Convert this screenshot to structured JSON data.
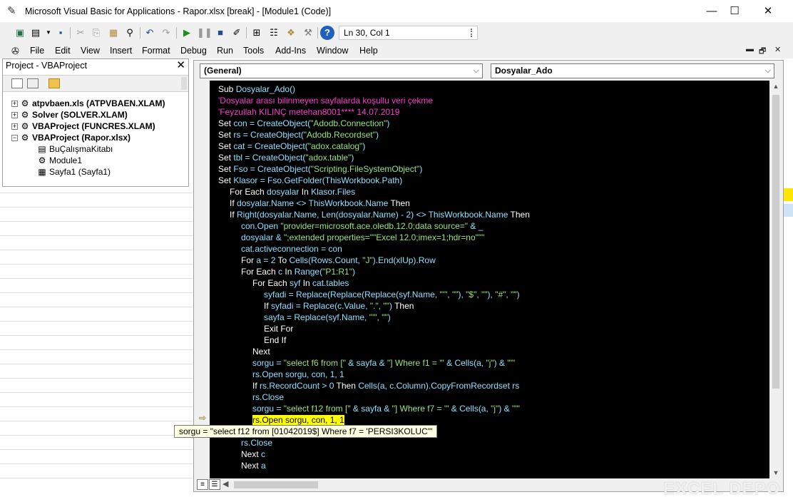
{
  "window": {
    "title": "Microsoft Visual Basic for Applications - Rapor.xlsx [break] - [Module1 (Code)]",
    "minimize": "—",
    "maximize": "☐",
    "close": "✕"
  },
  "toolbar": {
    "position": "Ln 30, Col 1",
    "icons": [
      "excel-view",
      "insert-userform",
      "save",
      "cut",
      "copy",
      "paste",
      "find",
      "undo",
      "redo",
      "run",
      "break",
      "reset",
      "design-mode",
      "project-explorer",
      "properties",
      "object-browser",
      "toolbox",
      "help"
    ]
  },
  "menu": {
    "items": [
      "File",
      "Edit",
      "View",
      "Insert",
      "Format",
      "Debug",
      "Run",
      "Tools",
      "Add-Ins",
      "Window",
      "Help"
    ],
    "accelerators": [
      "F",
      "E",
      "V",
      "I",
      "o",
      "D",
      "R",
      "T",
      "A",
      "W",
      "H"
    ],
    "mdi_minimize": "▬",
    "mdi_restore": "🗗",
    "mdi_close": "✕"
  },
  "project": {
    "title": "Project - VBAProject",
    "close": "✕",
    "tree": [
      {
        "label": "atpvbaen.xls (ATPVBAEN.XLAM)",
        "expander": "+",
        "bold": true
      },
      {
        "label": "Solver (SOLVER.XLAM)",
        "expander": "+",
        "bold": true
      },
      {
        "label": "VBAProject (FUNCRES.XLAM)",
        "expander": "+",
        "bold": true
      },
      {
        "label": "VBAProject (Rapor.xlsx)",
        "expander": "−",
        "bold": true
      },
      {
        "label": "BuÇalışmaKitabı",
        "expander": "",
        "bold": false
      },
      {
        "label": "Module1",
        "expander": "",
        "bold": false
      },
      {
        "label": "Sayfa1 (Sayfa1)",
        "expander": "",
        "bold": false
      }
    ]
  },
  "code_window": {
    "object_dropdown": "(General)",
    "procedure_dropdown": "Dosyalar_Ado",
    "tooltip": "sorgu = \"select f12 from [01042019$] Where f7 = 'PERSI3KOLUC'\"",
    "lines": [
      {
        "indent": 0,
        "parts": [
          [
            "kw",
            "Sub "
          ],
          [
            "id",
            "Dosyalar_Ado()"
          ]
        ]
      },
      {
        "indent": 0,
        "parts": [
          [
            "cmt",
            "'Dosyalar arası bilinmeyen sayfalarda koşullu veri çekme"
          ]
        ]
      },
      {
        "indent": 0,
        "parts": [
          [
            "cmt",
            "'Feyzullah KILINÇ metehan8001**** 14.07.2019"
          ]
        ]
      },
      {
        "indent": 0,
        "parts": [
          [
            "kw",
            "Set "
          ],
          [
            "id",
            "con = CreateObject("
          ],
          [
            "str",
            "\"Adodb.Connection\""
          ],
          [
            "id",
            ")"
          ]
        ]
      },
      {
        "indent": 0,
        "parts": [
          [
            "kw",
            "Set "
          ],
          [
            "id",
            "rs = CreateObject("
          ],
          [
            "str",
            "\"Adodb.Recordset\""
          ],
          [
            "id",
            ")"
          ]
        ]
      },
      {
        "indent": 0,
        "parts": [
          [
            "kw",
            "Set "
          ],
          [
            "id",
            "cat = CreateObject("
          ],
          [
            "str",
            "\"adox.catalog\""
          ],
          [
            "id",
            ")"
          ]
        ]
      },
      {
        "indent": 0,
        "parts": [
          [
            "kw",
            "Set "
          ],
          [
            "id",
            "tbl = CreateObject("
          ],
          [
            "str",
            "\"adox.table\""
          ],
          [
            "id",
            ")"
          ]
        ]
      },
      {
        "indent": 0,
        "parts": [
          [
            "kw",
            "Set "
          ],
          [
            "id",
            "Fso = CreateObject("
          ],
          [
            "str",
            "\"Scripting.FileSystemObject\""
          ],
          [
            "id",
            ")"
          ]
        ]
      },
      {
        "indent": 0,
        "parts": [
          [
            "kw",
            "Set "
          ],
          [
            "id",
            "Klasor = Fso.GetFolder(ThisWorkbook.Path)"
          ]
        ]
      },
      {
        "indent": 1,
        "parts": [
          [
            "kw",
            "For Each "
          ],
          [
            "id",
            "dosyalar "
          ],
          [
            "kw",
            "In "
          ],
          [
            "id",
            "Klasor.Files"
          ]
        ]
      },
      {
        "indent": 1,
        "parts": [
          [
            "kw",
            "If "
          ],
          [
            "id",
            "dosyalar.Name <> ThisWorkbook.Name "
          ],
          [
            "kw",
            "Then"
          ]
        ]
      },
      {
        "indent": 1,
        "parts": [
          [
            "kw",
            "If "
          ],
          [
            "id",
            "Right(dosyalar.Name, Len(dosyalar.Name) - 2) <> ThisWorkbook.Name "
          ],
          [
            "kw",
            "Then"
          ]
        ]
      },
      {
        "indent": 2,
        "parts": [
          [
            "id",
            "con.Open "
          ],
          [
            "str",
            "\"provider=microsoft.ace.oledb.12.0;data source=\""
          ],
          [
            "id",
            " & _"
          ]
        ]
      },
      {
        "indent": 2,
        "parts": [
          [
            "id",
            "dosyalar & "
          ],
          [
            "str",
            "\";extended properties=\"\"Excel 12.0;imex=1;hdr=no\"\"\""
          ]
        ]
      },
      {
        "indent": 2,
        "parts": [
          [
            "id",
            "cat.activeconnection = con"
          ]
        ]
      },
      {
        "indent": 2,
        "parts": [
          [
            "kw",
            "For "
          ],
          [
            "id",
            "a = 2 "
          ],
          [
            "kw",
            "To "
          ],
          [
            "id",
            "Cells(Rows.Count, "
          ],
          [
            "str",
            "\"J\""
          ],
          [
            "id",
            ").End(xlUp).Row"
          ]
        ]
      },
      {
        "indent": 2,
        "parts": [
          [
            "kw",
            "For Each "
          ],
          [
            "id",
            "c "
          ],
          [
            "kw",
            "In "
          ],
          [
            "id",
            "Range("
          ],
          [
            "str",
            "\"P1:R1\""
          ],
          [
            "id",
            ")"
          ]
        ]
      },
      {
        "indent": 3,
        "parts": [
          [
            "kw",
            "For Each "
          ],
          [
            "id",
            "syf "
          ],
          [
            "kw",
            "In "
          ],
          [
            "id",
            "cat.tables"
          ]
        ]
      },
      {
        "indent": 4,
        "parts": [
          [
            "id",
            "syfadi = Replace(Replace(Replace(syf.Name, "
          ],
          [
            "str",
            "\"'\""
          ],
          [
            "id",
            ", "
          ],
          [
            "str",
            "\"\""
          ],
          [
            "id",
            "), "
          ],
          [
            "str",
            "\"$\""
          ],
          [
            "id",
            ", "
          ],
          [
            "str",
            "\"\""
          ],
          [
            "id",
            "), "
          ],
          [
            "str",
            "\"#\""
          ],
          [
            "id",
            ", "
          ],
          [
            "str",
            "\"\""
          ],
          [
            "id",
            ")"
          ]
        ]
      },
      {
        "indent": 4,
        "parts": [
          [
            "kw",
            "If "
          ],
          [
            "id",
            "syfadi = Replace(c.Value, "
          ],
          [
            "str",
            "\".\""
          ],
          [
            "id",
            ", "
          ],
          [
            "str",
            "\"\""
          ],
          [
            "id",
            ") "
          ],
          [
            "kw",
            "Then"
          ]
        ]
      },
      {
        "indent": 4,
        "parts": [
          [
            "id",
            "sayfa = Replace(syf.Name, "
          ],
          [
            "str",
            "\"'\""
          ],
          [
            "id",
            ", "
          ],
          [
            "str",
            "\"\""
          ],
          [
            "id",
            ")"
          ]
        ]
      },
      {
        "indent": 4,
        "parts": [
          [
            "kw",
            "Exit For"
          ]
        ]
      },
      {
        "indent": 4,
        "parts": [
          [
            "kw",
            "End If"
          ]
        ]
      },
      {
        "indent": 3,
        "parts": [
          [
            "kw",
            "Next"
          ]
        ]
      },
      {
        "indent": 3,
        "parts": [
          [
            "id",
            "sorgu = "
          ],
          [
            "str",
            "\"select f6 from [\""
          ],
          [
            "id",
            " & sayfa & "
          ],
          [
            "str",
            "\"] Where f1 = '\""
          ],
          [
            "id",
            " & Cells(a, "
          ],
          [
            "str",
            "\"j\""
          ],
          [
            "id",
            ") & "
          ],
          [
            "str",
            "\"'\""
          ]
        ]
      },
      {
        "indent": 3,
        "parts": [
          [
            "id",
            "rs.Open sorgu, con, 1, 1"
          ]
        ]
      },
      {
        "indent": 3,
        "parts": [
          [
            "kw",
            "If "
          ],
          [
            "id",
            "rs.RecordCount > 0 "
          ],
          [
            "kw",
            "Then "
          ],
          [
            "id",
            "Cells(a, c.Column).CopyFromRecordset rs"
          ]
        ]
      },
      {
        "indent": 3,
        "parts": [
          [
            "id",
            "rs.Close"
          ]
        ]
      },
      {
        "indent": 3,
        "parts": [
          [
            "id",
            "sorgu = "
          ],
          [
            "str",
            "\"select f12 from [\""
          ],
          [
            "id",
            " & sayfa & "
          ],
          [
            "str",
            "\"] Where f7 = '\""
          ],
          [
            "id",
            " & Cells(a, "
          ],
          [
            "str",
            "\"j\""
          ],
          [
            "id",
            ") & "
          ],
          [
            "str",
            "\"'\""
          ]
        ]
      },
      {
        "indent": 3,
        "parts": [
          [
            "hl",
            "rs.Open sorgu, con, 1, 1"
          ]
        ]
      },
      {
        "indent": 3,
        "parts": [
          [
            "id",
            "Cells(a, c.Column + 1).Value = "
          ],
          [
            "id",
            "rs(0)"
          ]
        ]
      },
      {
        "indent": 2,
        "parts": [
          [
            "id",
            "rs.Close"
          ]
        ]
      },
      {
        "indent": 2,
        "parts": [
          [
            "kw",
            "Next "
          ],
          [
            "id",
            "c"
          ]
        ]
      },
      {
        "indent": 2,
        "parts": [
          [
            "kw",
            "Next "
          ],
          [
            "id",
            "a"
          ]
        ]
      }
    ],
    "line30_tail": "umn).CopyFromRecordset rs"
  },
  "watermark": "EXCEL DEPO",
  "colors": {
    "code_bg": "#000000",
    "keyword": "#ffffff",
    "identifier": "#8fe0ff",
    "string": "#9be37a",
    "comment": "#ff3ad0",
    "highlight": "#ffff00"
  }
}
